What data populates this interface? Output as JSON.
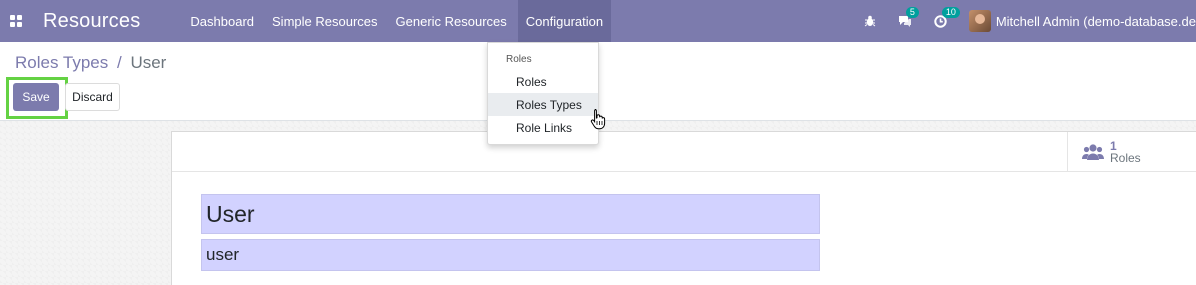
{
  "navbar": {
    "app_title": "Resources",
    "menu": [
      {
        "label": "Dashboard"
      },
      {
        "label": "Simple Resources"
      },
      {
        "label": "Generic Resources"
      },
      {
        "label": "Configuration"
      }
    ],
    "messages_count": "5",
    "activities_count": "10",
    "user_name": "Mitchell Admin (demo-database.de"
  },
  "breadcrumb": {
    "parent": "Roles Types",
    "separator": "/",
    "current": "User"
  },
  "buttons": {
    "save": "Save",
    "discard": "Discard"
  },
  "stat_button": {
    "value": "1",
    "label": "Roles"
  },
  "form": {
    "name": "User",
    "code": "user"
  },
  "dropdown": {
    "header": "Roles",
    "items": [
      {
        "label": "Roles"
      },
      {
        "label": "Roles Types"
      },
      {
        "label": "Role Links"
      }
    ]
  },
  "colors": {
    "brand": "#7c7bad",
    "active_menu": "#6a6a9b",
    "badge": "#00a09d",
    "field_bg": "#d2d2ff",
    "highlight": "#64d243"
  }
}
